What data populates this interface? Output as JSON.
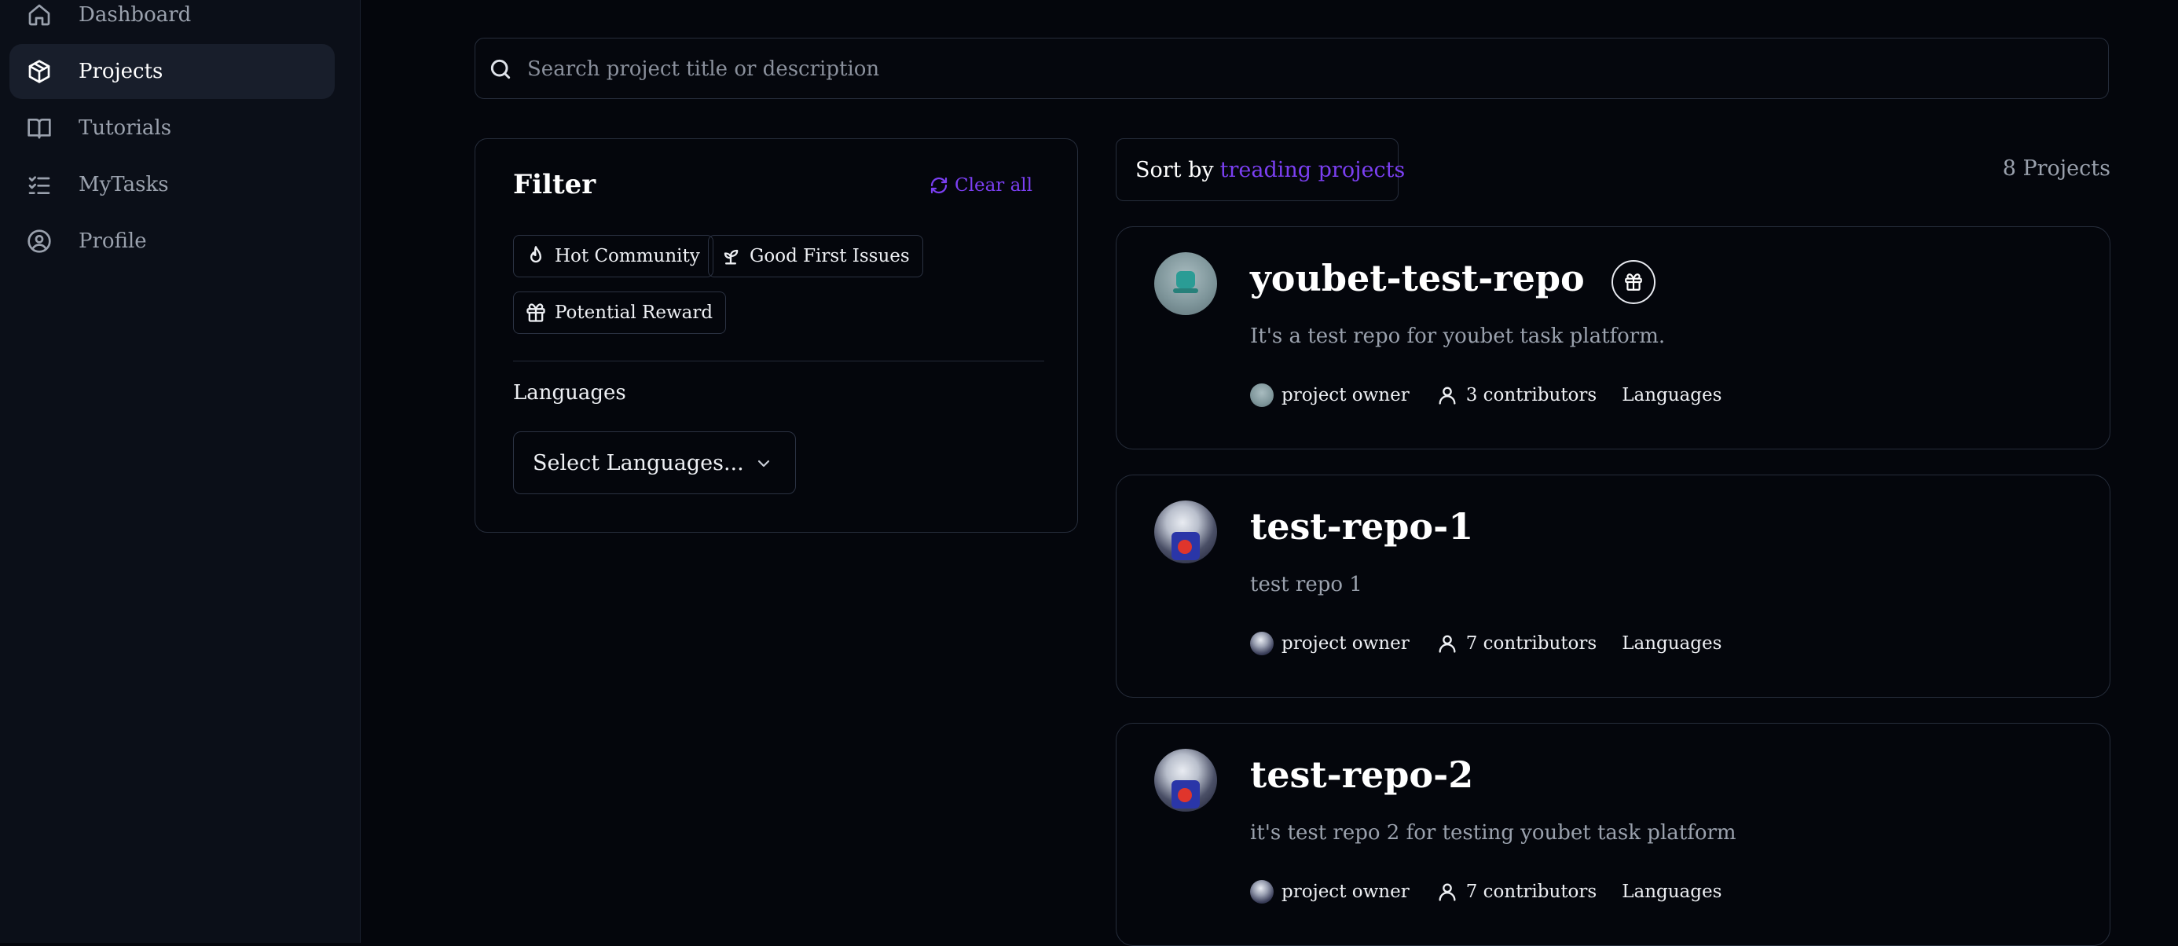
{
  "sidebar": {
    "items": [
      {
        "label": "Dashboard",
        "icon": "home-icon",
        "active": false
      },
      {
        "label": "Projects",
        "icon": "cube-icon",
        "active": true
      },
      {
        "label": "Tutorials",
        "icon": "book-icon",
        "active": false
      },
      {
        "label": "MyTasks",
        "icon": "list-checks-icon",
        "active": false
      },
      {
        "label": "Profile",
        "icon": "user-circle-icon",
        "active": false
      }
    ]
  },
  "search": {
    "placeholder": "Search project title or description",
    "value": ""
  },
  "filter": {
    "title": "Filter",
    "clear_label": "Clear all",
    "chips": [
      {
        "label": "Hot Community",
        "icon": "flame-icon"
      },
      {
        "label": "Good First Issues",
        "icon": "sprout-icon"
      },
      {
        "label": "Potential Reward",
        "icon": "gift-icon"
      }
    ],
    "languages_heading": "Languages",
    "languages_select": "Select Languages..."
  },
  "sort": {
    "prefix": "Sort by",
    "value": "treading projects"
  },
  "project_count": "8 Projects",
  "projects": [
    {
      "title": "youbet-test-repo",
      "description": "It's a test repo for youbet task platform.",
      "owner_label": "project owner",
      "contributors": "3 contributors",
      "languages_label": "Languages",
      "has_reward": true
    },
    {
      "title": "test-repo-1",
      "description": "test repo 1",
      "owner_label": "project owner",
      "contributors": "7 contributors",
      "languages_label": "Languages",
      "has_reward": false
    },
    {
      "title": "test-repo-2",
      "description": "it's test repo 2 for testing youbet task platform",
      "owner_label": "project owner",
      "contributors": "7 contributors",
      "languages_label": "Languages",
      "has_reward": false
    }
  ],
  "colors": {
    "accent": "#7b3ff2",
    "background": "#04060c",
    "sidebar": "#0b0f18",
    "border": "#262d3b"
  }
}
